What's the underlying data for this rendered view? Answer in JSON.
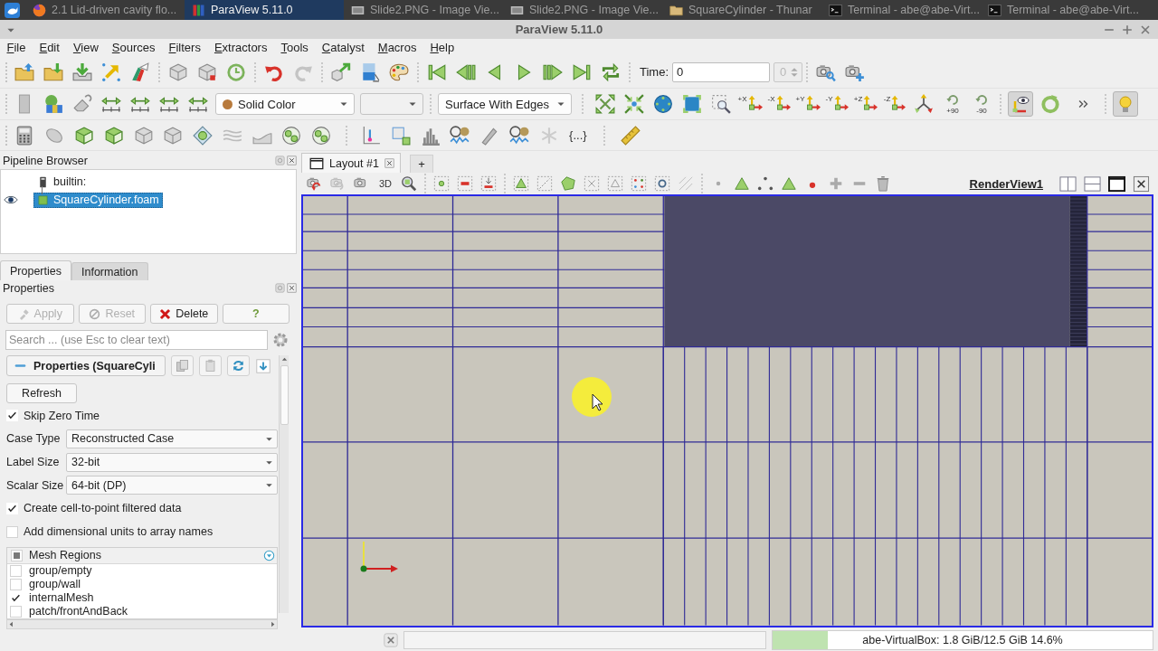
{
  "taskbar": {
    "items": [
      {
        "kind": "browser",
        "title": "2.1 Lid-driven cavity flo...",
        "selected": false
      },
      {
        "kind": "paraview",
        "title": "ParaView 5.11.0",
        "selected": true
      },
      {
        "kind": "image",
        "title": "Slide2.PNG - Image Vie...",
        "selected": false
      },
      {
        "kind": "image",
        "title": "Slide2.PNG - Image Vie...",
        "selected": false
      },
      {
        "kind": "folder",
        "title": "SquareCylinder - Thunar",
        "selected": false
      },
      {
        "kind": "terminal",
        "title": "Terminal - abe@abe-Virt...",
        "selected": false
      },
      {
        "kind": "terminal",
        "title": "Terminal - abe@abe-Virt...",
        "selected": false
      }
    ]
  },
  "window": {
    "title": "ParaView 5.11.0"
  },
  "menu": [
    "File",
    "Edit",
    "View",
    "Sources",
    "Filters",
    "Extractors",
    "Tools",
    "Catalyst",
    "Macros",
    "Help"
  ],
  "main_toolbar": {
    "time_label": "Time:",
    "time_value": "0",
    "timestep": {
      "value": "0",
      "disabled": true
    }
  },
  "view_toolbar": {
    "color_by": {
      "value": "Solid Color",
      "disabled": false
    },
    "component": {
      "disabled": true
    },
    "representation": {
      "value": "Surface With Edges",
      "disabled": false
    },
    "camera_views": [
      {
        "label": "+X"
      },
      {
        "label": "-X"
      },
      {
        "label": "+Y"
      },
      {
        "label": "-Y"
      },
      {
        "label": "+Z"
      },
      {
        "label": "-Z"
      }
    ],
    "rotations": [
      {
        "label": "+90"
      },
      {
        "label": "-90"
      }
    ],
    "orientation_axes_on": true,
    "light_kit_on": true
  },
  "filters_toolbar": {
    "braces_button": "{...}"
  },
  "pipeline_browser": {
    "title": "Pipeline Browser",
    "items": [
      {
        "label": "builtin:",
        "selected": false,
        "children": [
          {
            "label": "SquareCylinder.foam",
            "selected": true,
            "visible": true
          }
        ]
      }
    ]
  },
  "panel_tabs": [
    {
      "label": "Properties",
      "selected": true
    },
    {
      "label": "Information",
      "selected": false
    }
  ],
  "properties": {
    "title": "Properties",
    "buttons": [
      {
        "kind": "apply",
        "label": "Apply",
        "disabled": true
      },
      {
        "kind": "reset",
        "label": "Reset",
        "disabled": true
      },
      {
        "kind": "delete",
        "label": "Delete",
        "disabled": false
      },
      {
        "kind": "help",
        "label": "?",
        "disabled": false
      }
    ],
    "search": {
      "placeholder": "Search ... (use Esc to clear text)"
    },
    "section": {
      "title": "Properties (SquareCyli",
      "expanded": true
    },
    "refresh_button": "Refresh",
    "fields": [
      {
        "kind": "checkbox",
        "label": "Skip Zero Time",
        "checked": true
      },
      {
        "kind": "dropdown",
        "label": "Case Type",
        "value": "Reconstructed Case"
      },
      {
        "kind": "dropdown",
        "label": "Label Size",
        "value": "32-bit"
      },
      {
        "kind": "dropdown",
        "label": "Scalar Size",
        "value": "64-bit (DP)"
      },
      {
        "kind": "checkbox",
        "label": "Create cell-to-point filtered data",
        "checked": true
      },
      {
        "kind": "checkbox",
        "label": "Add dimensional units to array names",
        "checked": false
      }
    ],
    "mesh_regions": {
      "title": "Mesh Regions",
      "partially_checked": true,
      "items": [
        {
          "label": "group/empty",
          "checked": false
        },
        {
          "label": "group/wall",
          "checked": false
        },
        {
          "label": "internalMesh",
          "checked": true
        },
        {
          "label": "patch/frontAndBack",
          "checked": false
        }
      ]
    }
  },
  "layout_tabs": [
    {
      "label": "Layout #1",
      "selected": true
    }
  ],
  "new_layout_button": "+",
  "render_view": {
    "title": "RenderView1",
    "camera_mode": "3D"
  },
  "status_bar": {
    "memory": {
      "label": "abe-VirtualBox: 1.8 GiB/12.5 GiB 14.6%",
      "level": 0.146
    }
  }
}
